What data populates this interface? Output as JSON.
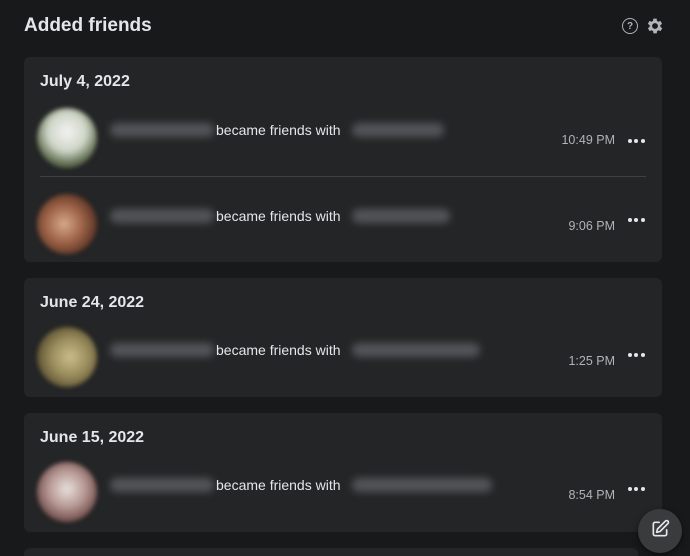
{
  "header": {
    "title": "Added friends",
    "help_icon": "help-circle-icon",
    "settings_icon": "gear-icon"
  },
  "colors": {
    "background": "#18191a",
    "card": "#242526",
    "text_primary": "#e4e6eb",
    "text_secondary": "#b0b3b8"
  },
  "groups": [
    {
      "date": "July 4, 2022",
      "entries": [
        {
          "action": "became friends with",
          "time": "10:49 PM"
        },
        {
          "action": "became friends with",
          "time": "9:06 PM"
        }
      ]
    },
    {
      "date": "June 24, 2022",
      "entries": [
        {
          "action": "became friends with",
          "time": "1:25 PM"
        }
      ]
    },
    {
      "date": "June 15, 2022",
      "entries": [
        {
          "action": "became friends with",
          "time": "8:54 PM"
        }
      ]
    }
  ],
  "compose_icon": "edit-icon"
}
